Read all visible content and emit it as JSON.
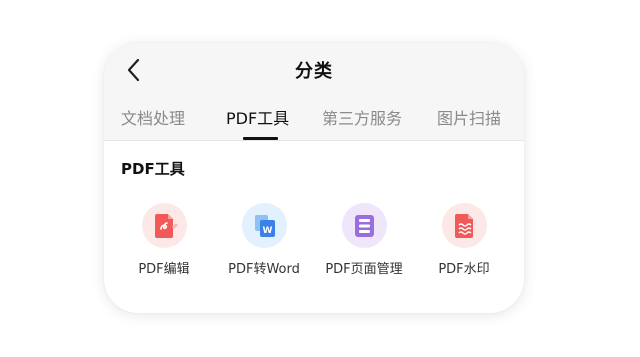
{
  "header": {
    "title": "分类",
    "back_icon": "chevron-left-icon"
  },
  "tabs": [
    {
      "label": "文档处理",
      "active": false
    },
    {
      "label": "PDF工具",
      "active": true
    },
    {
      "label": "第三方服务",
      "active": false
    },
    {
      "label": "图片扫描",
      "active": false
    }
  ],
  "section": {
    "title": "PDF工具"
  },
  "tools": [
    {
      "label": "PDF编辑",
      "icon": "pdf-edit-icon",
      "icon_color": "#f25a5a",
      "bg_color": "#fde8e8"
    },
    {
      "label": "PDF转Word",
      "icon": "pdf-to-word-icon",
      "icon_color": "#3b82e8",
      "bg_color": "#e3f0fd"
    },
    {
      "label": "PDF页面管理",
      "icon": "pdf-page-manage-icon",
      "icon_color": "#9b6ee0",
      "bg_color": "#efe6fb"
    },
    {
      "label": "PDF水印",
      "icon": "pdf-watermark-icon",
      "icon_color": "#f25a5a",
      "bg_color": "#fde8e8"
    }
  ],
  "colors": {
    "header_bg": "#f6f6f6",
    "active_text": "#111111",
    "inactive_text": "#8a8a8a"
  }
}
